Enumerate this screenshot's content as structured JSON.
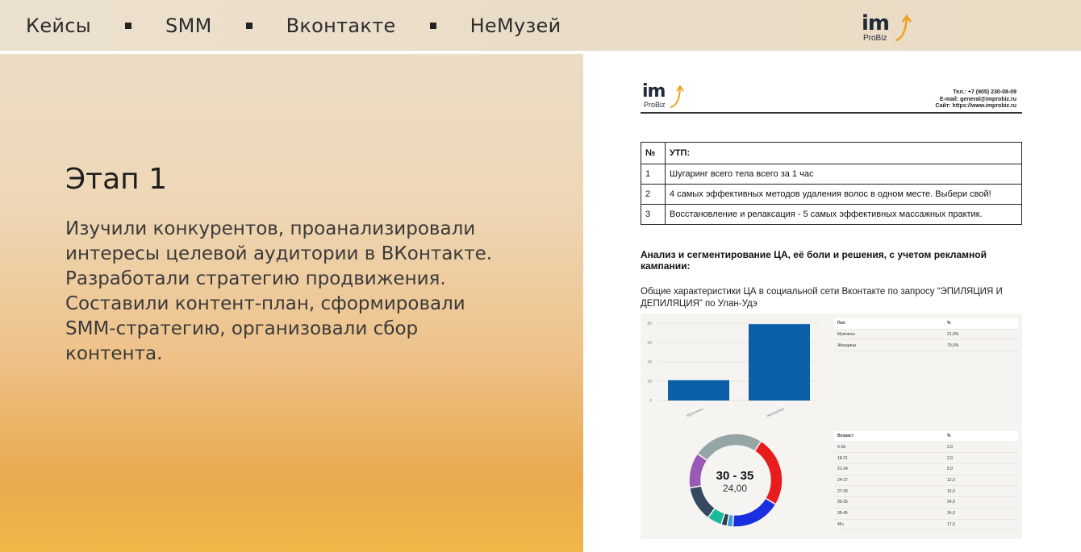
{
  "nav": {
    "items": [
      "Кейсы",
      "SMM",
      "Вконтакте",
      "НеМузей"
    ]
  },
  "logo": {
    "main": "im",
    "sub": "ProBiz",
    "accent_color": "#f0a020"
  },
  "stage": {
    "title": "Этап 1",
    "text": "Изучили конкурентов, проанализировали интересы целевой аудитории в ВКонтакте. Разработали стратегию продвижения. Составили контент-план, сформировали SMM-стратегию, организовали сбор контента."
  },
  "document": {
    "contacts": [
      "Тел.: +7 (905) 230-08-09",
      "E-mail: general@improbiz.ru",
      "Сайт: https://www.improbiz.ru"
    ],
    "utp_table": {
      "header": [
        "№",
        "УТП:"
      ],
      "rows": [
        [
          "1",
          "Шугаринг всего тела всего за 1 час"
        ],
        [
          "2",
          "4 самых эффективных методов удаления волос в одном месте. Выбери свой!"
        ],
        [
          "3",
          "Восстановление и релаксация - 5 самых эффективных массажных практик."
        ]
      ]
    },
    "analysis_title": "Анализ и сегментирование ЦА, её боли и решения, с учетом рекламной кампании:",
    "analysis_sub": " Общие характеристики ЦА в социальной сети Вконтакте по запросу “ЭПИЛЯЦИЯ И ДЕПИЛЯЦИЯ” по Улан-Удэ",
    "gender_table": {
      "header": [
        "Пол",
        "%"
      ],
      "rows": [
        [
          "Мужчины",
          "21,0%"
        ],
        [
          "Женщины",
          "79,0%"
        ]
      ]
    },
    "age_table": {
      "header": [
        "Возраст",
        "%"
      ],
      "rows": [
        [
          "0-18",
          "2,0"
        ],
        [
          "18-21",
          "2,0"
        ],
        [
          "21-24",
          "5,0"
        ],
        [
          "24-27",
          "12,0"
        ],
        [
          "27-30",
          "12,0"
        ],
        [
          "30-35",
          "24,0"
        ],
        [
          "35-45",
          "24,0"
        ],
        [
          "45+",
          "17,0"
        ]
      ]
    },
    "donut_label": "30 - 35",
    "donut_value": "24,00"
  },
  "chart_data": [
    {
      "type": "bar",
      "categories": [
        "Мужчины",
        "Женщины"
      ],
      "values": [
        21,
        79
      ],
      "ylim": [
        0,
        80
      ],
      "yticks": [
        "0",
        "20",
        "40",
        "60",
        "80"
      ],
      "color": "#0a5fa6"
    },
    {
      "type": "pie",
      "categories": [
        "0-18",
        "18-21",
        "21-24",
        "24-27",
        "27-30",
        "30-35",
        "35-45",
        "45+"
      ],
      "values": [
        2,
        2,
        5,
        12,
        12,
        24,
        24,
        17
      ],
      "colors": [
        "#3a9ad9",
        "#2c3e50",
        "#1abc9c",
        "#34495e",
        "#9b59b6",
        "#95a5a6",
        "#e81c1c",
        "#1a2fe0"
      ]
    }
  ]
}
